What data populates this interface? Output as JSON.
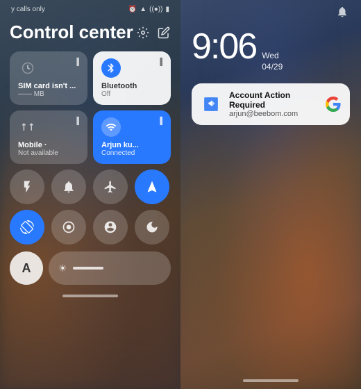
{
  "left": {
    "status": {
      "calls_only": "y calls only",
      "icons": [
        "⏰",
        "📶",
        "🔋"
      ]
    },
    "title": "Control center",
    "tiles": [
      {
        "id": "sim",
        "label": "SIM card isn't ...",
        "sublabel": "—— MB",
        "icon": "💧",
        "active": false
      },
      {
        "id": "bluetooth",
        "label": "Bluetooth",
        "sublabel": "Off",
        "icon": "✳",
        "active": true
      },
      {
        "id": "mobile",
        "label": "Mobile ·",
        "sublabel": "Not available",
        "icon": "📶",
        "active": false
      },
      {
        "id": "wifi",
        "label": "Arjun ku...",
        "sublabel": "Connected",
        "icon": "📶",
        "active": true
      }
    ],
    "icon_row1": [
      {
        "id": "flashlight",
        "icon": "🔦",
        "active": false
      },
      {
        "id": "bell",
        "icon": "🔔",
        "active": false
      },
      {
        "id": "airplane",
        "icon": "✈",
        "active": false
      },
      {
        "id": "location",
        "icon": "➤",
        "active": true
      }
    ],
    "icon_row2": [
      {
        "id": "autorotate",
        "icon": "⟳",
        "active": true
      },
      {
        "id": "eye",
        "icon": "👁",
        "active": false
      },
      {
        "id": "circle_i",
        "icon": "ⓘ",
        "active": false
      },
      {
        "id": "moon",
        "icon": "🌙",
        "active": false
      }
    ],
    "auto_label": "A",
    "brightness_icon": "☀"
  },
  "right": {
    "time": "9:06",
    "date_day": "Wed",
    "date": "04/29",
    "bell_icon": "🔔",
    "notification": {
      "title": "Account Action Required",
      "subtitle": "arjun@beebom.com",
      "app_icon": "puzzle"
    }
  }
}
